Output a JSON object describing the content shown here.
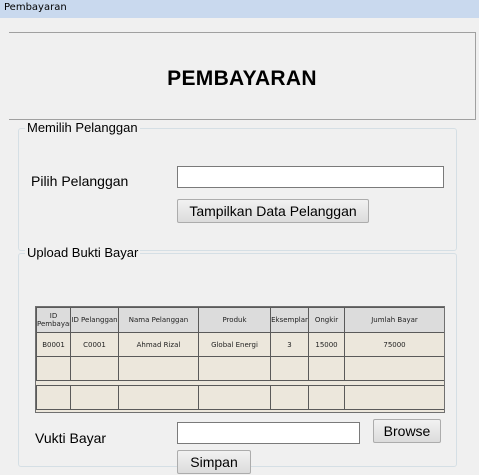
{
  "window": {
    "title": "Pembayaran"
  },
  "header": {
    "title": "PEMBAYARAN"
  },
  "pelanggan_group": {
    "legend": "Memilih Pelanggan",
    "label": "Pilih Pelanggan",
    "input_value": "",
    "button_label": "Tampilkan Data Pelanggan"
  },
  "upload_group": {
    "legend": "Upload Bukti Bayar",
    "table": {
      "columns": [
        "ID Pembayaran",
        "ID Pelanggan",
        "Nama Pelanggan",
        "Produk",
        "Eksemplar",
        "Ongkir",
        "Jumlah Bayar"
      ],
      "rows": [
        [
          "B0001",
          "C0001",
          "Ahmad Rizal",
          "Global Energi",
          "3",
          "15000",
          "75000"
        ]
      ]
    },
    "bukti_label": "Vukti Bayar",
    "bukti_value": "",
    "browse_label": "Browse",
    "simpan_label": "Simpan"
  }
}
